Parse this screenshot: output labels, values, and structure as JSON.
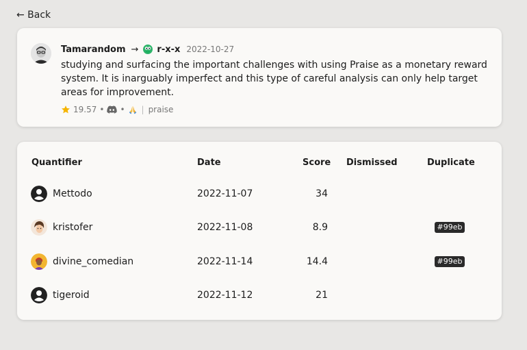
{
  "nav": {
    "back_label": "← Back"
  },
  "praise": {
    "giver": "Tamarandom",
    "arrow": "→",
    "receiver": "r-x-x",
    "date": "2022-10-27",
    "text": "studying and surfacing the important challenges with using Praise as a monetary reward system. It is inarguably imperfect and this type of careful analysis can only help target areas for improvement.",
    "score": "19.57",
    "separator": "•",
    "divider": "|",
    "source_channel": "praise",
    "icons": [
      "star-icon",
      "discord-icon",
      "folded-hands-icon"
    ]
  },
  "table": {
    "headers": {
      "quantifier": "Quantifier",
      "date": "Date",
      "score": "Score",
      "dismissed": "Dismissed",
      "duplicate": "Duplicate"
    },
    "rows": [
      {
        "name": "Mettodo",
        "date": "2022-11-07",
        "score": "34",
        "dismissed": "",
        "duplicate": "",
        "avatar": "default-user-icon"
      },
      {
        "name": "kristofer",
        "date": "2022-11-08",
        "score": "8.9",
        "dismissed": "",
        "duplicate": "#99eb",
        "avatar": "kristofer-avatar"
      },
      {
        "name": "divine_comedian",
        "date": "2022-11-14",
        "score": "14.4",
        "dismissed": "",
        "duplicate": "#99eb",
        "avatar": "divine-comedian-avatar"
      },
      {
        "name": "tigeroid",
        "date": "2022-11-12",
        "score": "21",
        "dismissed": "",
        "duplicate": "",
        "avatar": "default-user-icon"
      }
    ]
  }
}
